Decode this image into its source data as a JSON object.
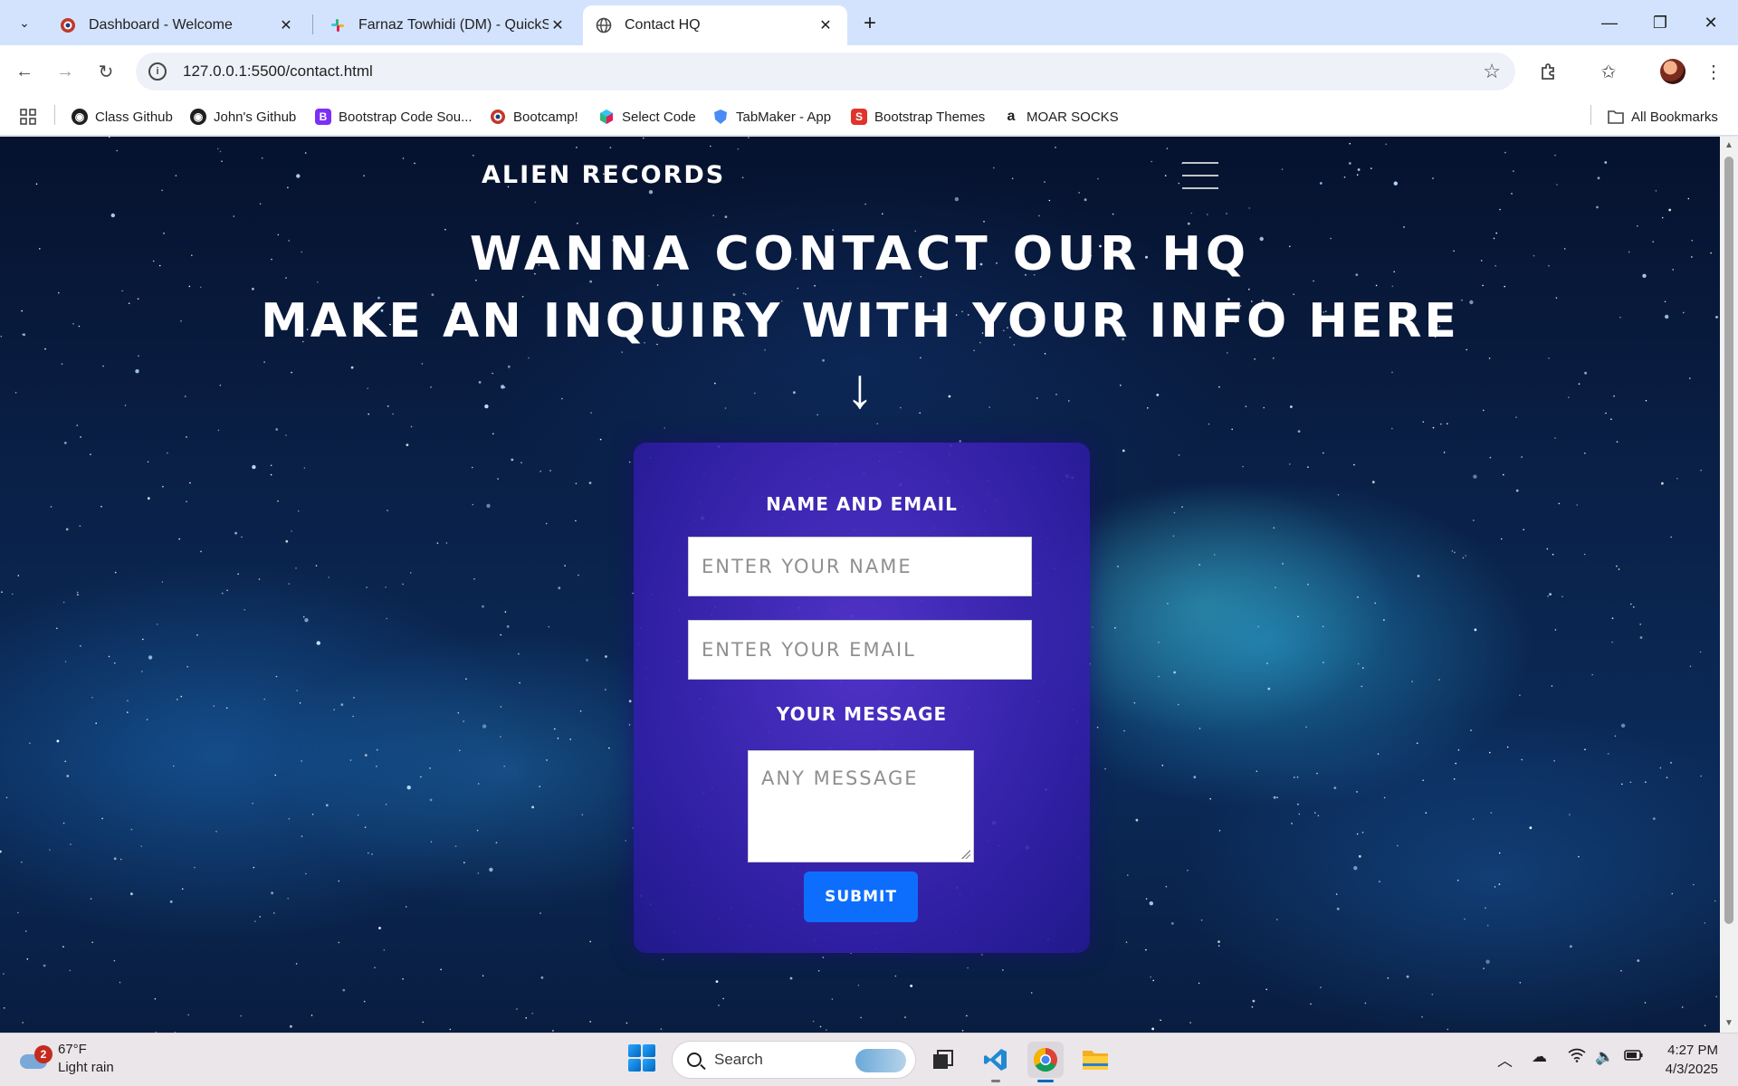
{
  "browser": {
    "tabs": [
      {
        "title": "Dashboard - Welcome",
        "favicon": "bootcamp-icon",
        "active": false
      },
      {
        "title": "Farnaz Towhidi (DM) - QuickSta",
        "favicon": "slack-icon",
        "active": false
      },
      {
        "title": "Contact HQ",
        "favicon": "globe-icon",
        "active": true
      }
    ],
    "url": "127.0.0.1:5500/contact.html"
  },
  "bookmarks": {
    "items": [
      {
        "label": "Class Github",
        "icon": "github-icon"
      },
      {
        "label": "John's Github",
        "icon": "github-icon"
      },
      {
        "label": "Bootstrap Code Sou...",
        "icon": "bootstrap-icon"
      },
      {
        "label": "Bootcamp!",
        "icon": "bootcamp-icon"
      },
      {
        "label": "Select Code",
        "icon": "cube-icon"
      },
      {
        "label": "TabMaker - App",
        "icon": "tabmaker-icon"
      },
      {
        "label": "Bootstrap Themes",
        "icon": "bootstrap-themes-icon"
      },
      {
        "label": "MOAR SOCKS",
        "icon": "amazon-icon"
      }
    ],
    "all_bookmarks": "All Bookmarks"
  },
  "page": {
    "brand": "Alien Records",
    "heading_line1": "Wanna contact our HQ",
    "heading_line2": "Make an inquiry with your info here",
    "arrow": "↓",
    "form": {
      "section1_label": "Name and Email",
      "name_placeholder": "Enter your name",
      "email_placeholder": "Enter your email",
      "section2_label": "Your message",
      "message_placeholder": "Any message",
      "submit_label": "Submit"
    },
    "colors": {
      "card": "#4a2fd0",
      "submit": "#0d6efd"
    }
  },
  "taskbar": {
    "weather_temp": "67°F",
    "weather_desc": "Light rain",
    "weather_badge": "2",
    "search_label": "Search",
    "time": "4:27 PM",
    "date": "4/3/2025"
  }
}
